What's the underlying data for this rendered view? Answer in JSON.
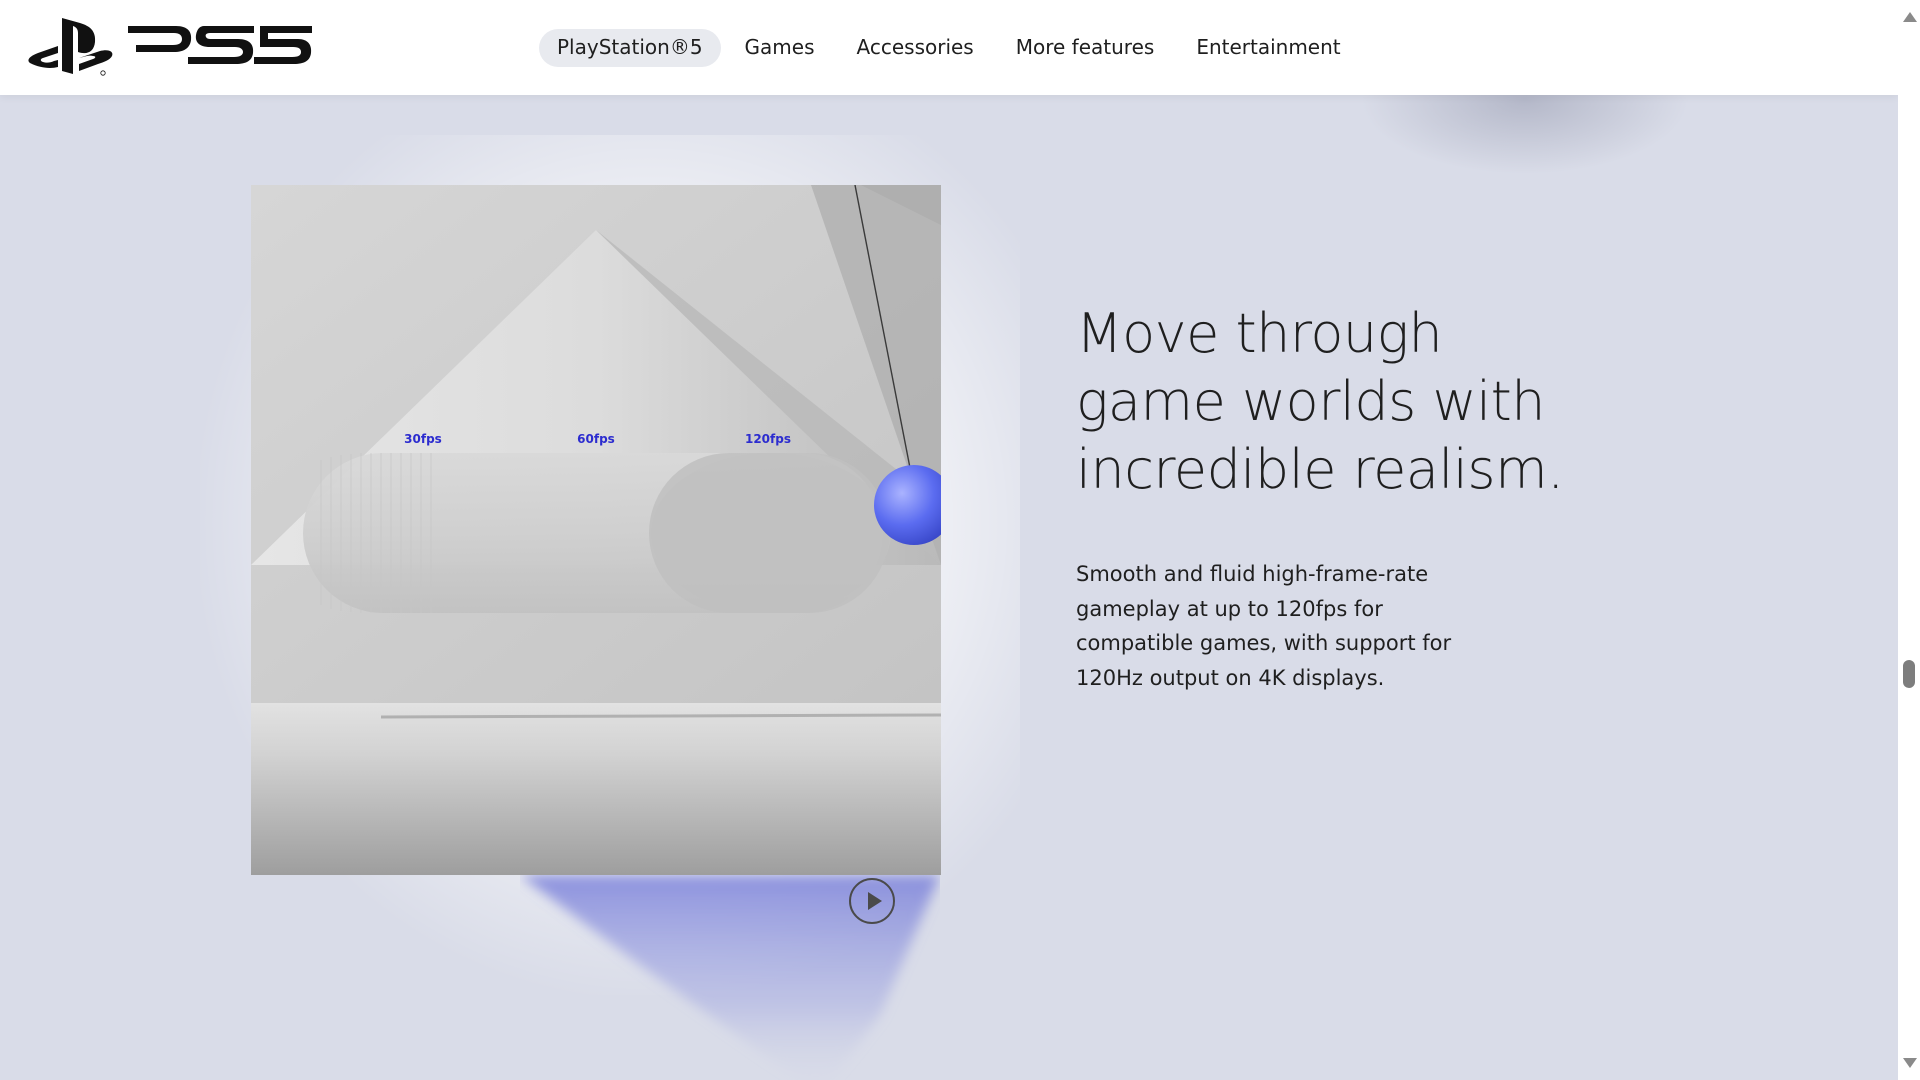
{
  "header": {
    "logo": "PlayStation 5 logo",
    "nav": [
      {
        "label": "PlayStation®5",
        "active": true
      },
      {
        "label": "Games",
        "active": false
      },
      {
        "label": "Accessories",
        "active": false
      },
      {
        "label": "More features",
        "active": false
      },
      {
        "label": "Entertainment",
        "active": false
      }
    ]
  },
  "feature": {
    "video": {
      "labels": [
        "30fps",
        "60fps",
        "120fps"
      ],
      "play_icon": "play-icon"
    },
    "headline": "Move through game worlds with incredible realism.",
    "body": "Smooth and fluid high-frame-rate gameplay at up to 120fps for compatible games, with support for 120Hz output on 4K displays."
  },
  "colors": {
    "page_background": "#d9dce8",
    "header_background": "#ffffff",
    "active_nav_pill": "#e8eaef",
    "accent_blue": "#5a6ae6",
    "text": "#1f1f1f"
  }
}
